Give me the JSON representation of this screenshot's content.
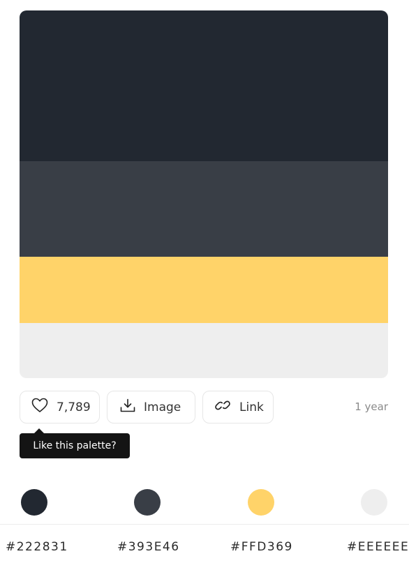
{
  "palette": {
    "colors": [
      {
        "hex": "#222831",
        "fill": "#222831"
      },
      {
        "hex": "#393E46",
        "fill": "#393e46"
      },
      {
        "hex": "#FFD369",
        "fill": "#ffd369"
      },
      {
        "hex": "#EEEEEE",
        "fill": "#eeeeee"
      }
    ]
  },
  "actions": {
    "like_count": "7,789",
    "image_label": "Image",
    "link_label": "Link"
  },
  "age": "1 year",
  "tooltip": "Like this palette?"
}
